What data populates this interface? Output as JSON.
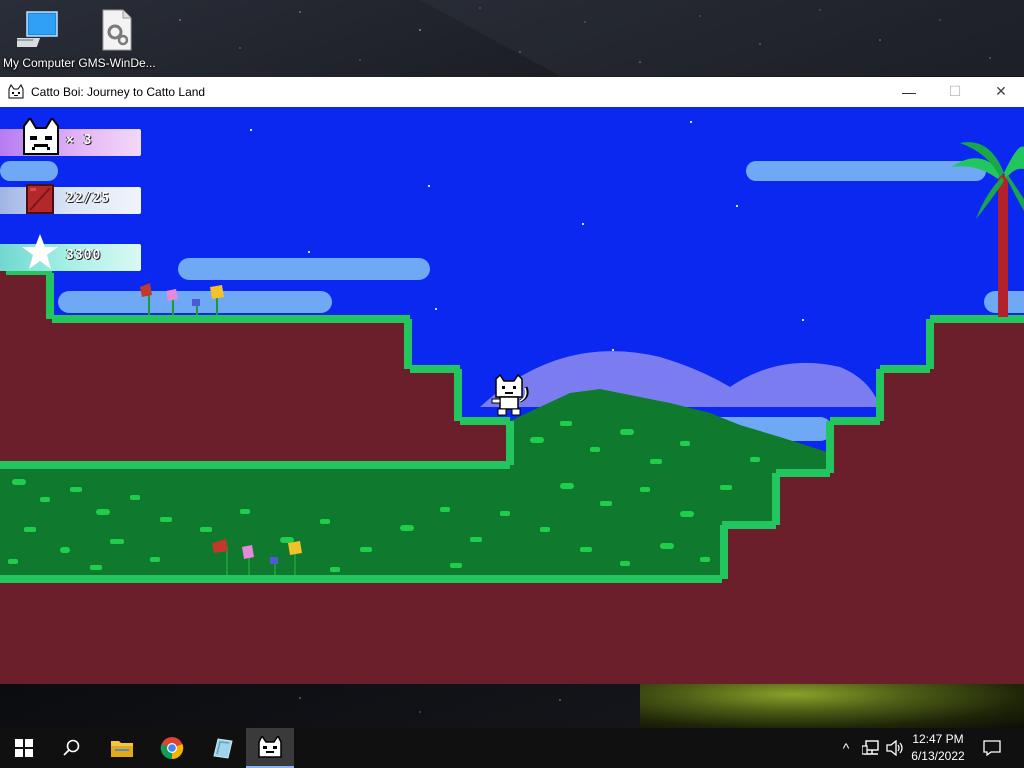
{
  "desktop": {
    "icons": [
      {
        "label": "My Computer",
        "icon": "computer-icon"
      },
      {
        "label": "GMS-WinDe...",
        "icon": "settings-file-icon"
      }
    ]
  },
  "window": {
    "title": "Catto Boi: Journey to Catto Land",
    "controls": {
      "minimize": "—",
      "maximize": "☐",
      "close": "✕"
    }
  },
  "hud": {
    "lives": "× 3",
    "bricks": "22/25",
    "score": "3300"
  },
  "taskbar": {
    "items": [
      {
        "name": "start",
        "icon": "windows-start-icon"
      },
      {
        "name": "search",
        "icon": "search-icon"
      },
      {
        "name": "file-explorer",
        "icon": "folder-icon"
      },
      {
        "name": "chrome",
        "icon": "chrome-icon"
      },
      {
        "name": "gamemaker",
        "icon": "gamemaker-icon"
      },
      {
        "name": "catto-boi",
        "icon": "cat-app-icon",
        "active": true
      }
    ],
    "tray": {
      "chevron": "^"
    },
    "clock": {
      "time": "12:47 PM",
      "date": "6/13/2022"
    }
  },
  "colors": {
    "sky": "#0b28f0",
    "dirt": "#6b1f2a",
    "grass": "#22c55e",
    "bush": "#0f7a2e",
    "cloud": "#6fa8f5",
    "hill": "#7a7cf0",
    "hud_lives": "#d9a8f0",
    "hud_bricks": "#dce6f5",
    "hud_score": "#a8f0e8"
  }
}
